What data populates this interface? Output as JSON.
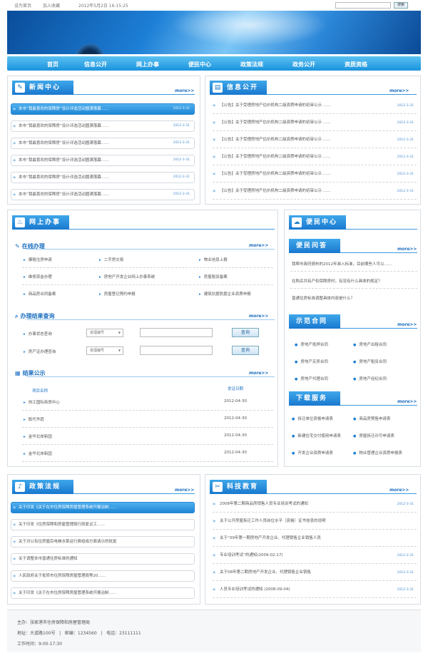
{
  "topbar": {
    "set_home": "设为首页",
    "favorite": "加入收藏",
    "datetime": "2012年5月2日 16:15:25",
    "search_btn": "搜索"
  },
  "nav": [
    "首页",
    "信息公开",
    "网上办事",
    "便民中心",
    "政策法规",
    "政务公开",
    "资质资格"
  ],
  "more": "more>>",
  "news": {
    "title": "新闻中心",
    "items": [
      "本市“我最喜欢的保障房”设计评选活动圆满落幕……",
      "本市“我最喜欢的保障房”设计评选活动圆满落幕……",
      "本市“我最喜欢的保障房”设计评选活动圆满落幕……",
      "本市“我最喜欢的保障房”设计评选活动圆满落幕……",
      "本市“我最喜欢的保障房”设计评选活动圆满落幕……",
      "本市“我最喜欢的保障房”设计评选活动圆满落幕……"
    ],
    "date": "2012-3-31"
  },
  "info": {
    "title": "信息公开",
    "items": [
      "【公告】关于受理房地产估价机构二级资质申请的初审公示 ……",
      "【公告】关于受理房地产估价机构二级资质申请的初审公示 ……",
      "【公告】关于受理房地产估价机构二级资质申请的初审公示 ……",
      "【公告】关于受理房地产估价机构二级资质申请的初审公示 ……",
      "【公告】关于受理房地产估价机构二级资质申请的初审公示 ……",
      "【公告】关于受理房地产估价机构二级资质申请的初审公示 ……"
    ],
    "date": "2012-3-31"
  },
  "online": {
    "title": "网上办事",
    "sub_online": "在线办理",
    "services": [
      "廉租住房申请",
      "二手房交易",
      "物业信息上报",
      "维修资金办理",
      "房地产开发企业网上办事系统",
      "房屋租赁备案",
      "商品房合同备案",
      "房屋登记预约申报",
      "建筑抗震防震企业资质申报"
    ],
    "sub_query": "办理结果查询",
    "q1_label": "办事状态查询",
    "q2_label": "房产证办理查询",
    "select": "受理编号",
    "query_btn": "查询",
    "sub_result": "结果公示",
    "col_name": "项目名称",
    "col_date": "发证日期",
    "results": [
      {
        "name": "休江国际商贸中心",
        "date": "2012-04-30"
      },
      {
        "name": "既代华庭",
        "date": "2012-04-30"
      },
      {
        "name": "金华北岸新园",
        "date": "2012-04-30"
      },
      {
        "name": "金华北岸新园",
        "date": "2012-04-30"
      }
    ]
  },
  "service": {
    "title": "便民中心",
    "qa_title": "便民问答",
    "qa": [
      "我帮市政府颁布的2012年准入标准，目前哪些人可以……",
      "在购买共有产权保障房时，有没有什么具体的规定？",
      "普通住房标准调整具体内容是什么？"
    ],
    "contract_title": "示范合同",
    "contracts": [
      "房地产抵押合同",
      "房地产出租合同",
      "房地产买卖合同",
      "房地产租赁合同",
      "房地产代理合同",
      "房地产经纪合同"
    ],
    "download_title": "下载服务",
    "downloads": [
      "拆迁单位资格申请表",
      "商品房预售申请表",
      "新建住宅交付使用申请表",
      "房屋拆迁许可申请表",
      "开发企业资质申请表",
      "物业管理企业资质申报表"
    ]
  },
  "policy": {
    "title": "政策法规",
    "items": [
      "关于印发《关于在市住房保障房屋管理系统开展治制……",
      "关于印发《住房保障和房屋管理局行政复议工……",
      "关于对公有住房屋后电梯水泵运行费组成方面请示的批复",
      "关于调整本市普通住房标准的通知",
      "人民政府关于批转市住房保障房屋管理局等20……",
      "关于印发《关于在市住房保障房屋管理系统开展治制……"
    ]
  },
  "edu": {
    "title": "科技教育",
    "items": [
      "2008年第二期商品房销售人员专业培训考试的通知",
      "关于公开房屋拆迁工作人员岗位水平（资格）证书信息的说明",
      "关于“09年第一期房地产开发企业、代理销售企业销售人员",
      "专业培训考试”的通知(2009-02-17)",
      "关于08年第二期房地产开发企业、代理销售企业销售",
      "人员专业培训考试的通知 (2008-09-04)"
    ],
    "date": "2012-3-31"
  },
  "footer": {
    "line1": "主办：张家港市住房保障和房屋管理局",
    "line2": "地址：大道路100号   |   邮编：1234560   |   电话：23111111",
    "line3": "工作时间：9:00-17:30"
  }
}
